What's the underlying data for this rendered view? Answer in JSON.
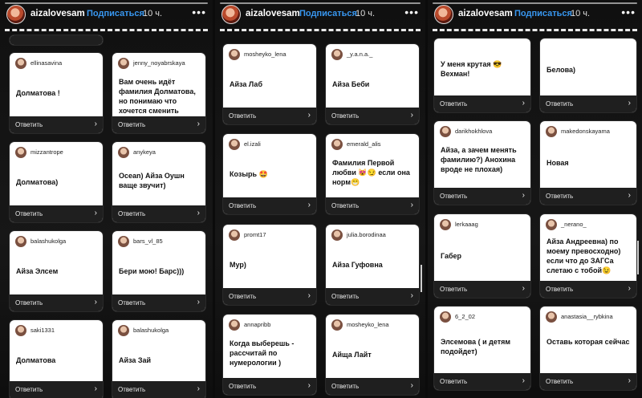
{
  "story": {
    "username": "aizalovesam",
    "follow_label": "Подписаться",
    "time": "10 ч.",
    "more_label": "•••"
  },
  "reply_label": "Ответить",
  "panels": [
    {
      "cards": [
        {
          "user": "",
          "text": ""
        },
        {
          "user": "ellinasavina",
          "text": "Долматова !"
        },
        {
          "user": "jenny_noyabrskaya",
          "text": "Вам очень идёт фамилия Долматова, но понимаю что хочется сменить"
        },
        {
          "user": "mizzantrope",
          "text": "Долматова)"
        },
        {
          "user": "anykeya",
          "text": "Ocean) Айза Оушн ваще звучит)"
        },
        {
          "user": "balashukolga",
          "text": "Айза Элсем"
        },
        {
          "user": "bars_vl_85",
          "text": "Бери мою! Барс)))"
        },
        {
          "user": "saki1331",
          "text": "Долматова"
        },
        {
          "user": "balashukolga",
          "text": "Айза Зай"
        }
      ]
    },
    {
      "cards": [
        {
          "user": "mosheyko_lena",
          "text": "Айза Лаб"
        },
        {
          "user": "_y.a.n.a._",
          "text": "Айза Беби"
        },
        {
          "user": "el.izali",
          "text": "Козырь 🤩"
        },
        {
          "user": "emerald_alis",
          "text": "Фамилия Первой любви 😻😏 если она норм😁"
        },
        {
          "user": "promt17",
          "text": "Мур)"
        },
        {
          "user": "julia.borodinaa",
          "text": "Айза Гуфовна"
        },
        {
          "user": "annapribb",
          "text": "Когда выберешь - рассчитай по нумерологии )"
        },
        {
          "user": "mosheyko_lena",
          "text": "Айща Лайт"
        }
      ]
    },
    {
      "cards": [
        {
          "user": "",
          "text": "У меня крутая 😎Вехман!"
        },
        {
          "user": "",
          "text": "Белова)"
        },
        {
          "user": "darikhokhlova",
          "text": "Айза, а зачем менять фамилию?) Анохина вроде не плохая)"
        },
        {
          "user": "makedonskayama",
          "text": "Новая"
        },
        {
          "user": "lerkaaag",
          "text": "Габер"
        },
        {
          "user": "_nerano_",
          "text": "Айза Андреевна) по моему превосходно) если что до ЗАГСа слетаю с тобой😉"
        },
        {
          "user": "6_2_02",
          "text": "Элсемова ( и детям подойдет)"
        },
        {
          "user": "anastasia__rybkina",
          "text": "Оставь которая сейчас"
        }
      ]
    }
  ],
  "colors": {
    "follow": "#3897f0",
    "card_bg": "#ffffff",
    "reply_bar": "#1f1f1f",
    "background": "#0b0b0b"
  }
}
